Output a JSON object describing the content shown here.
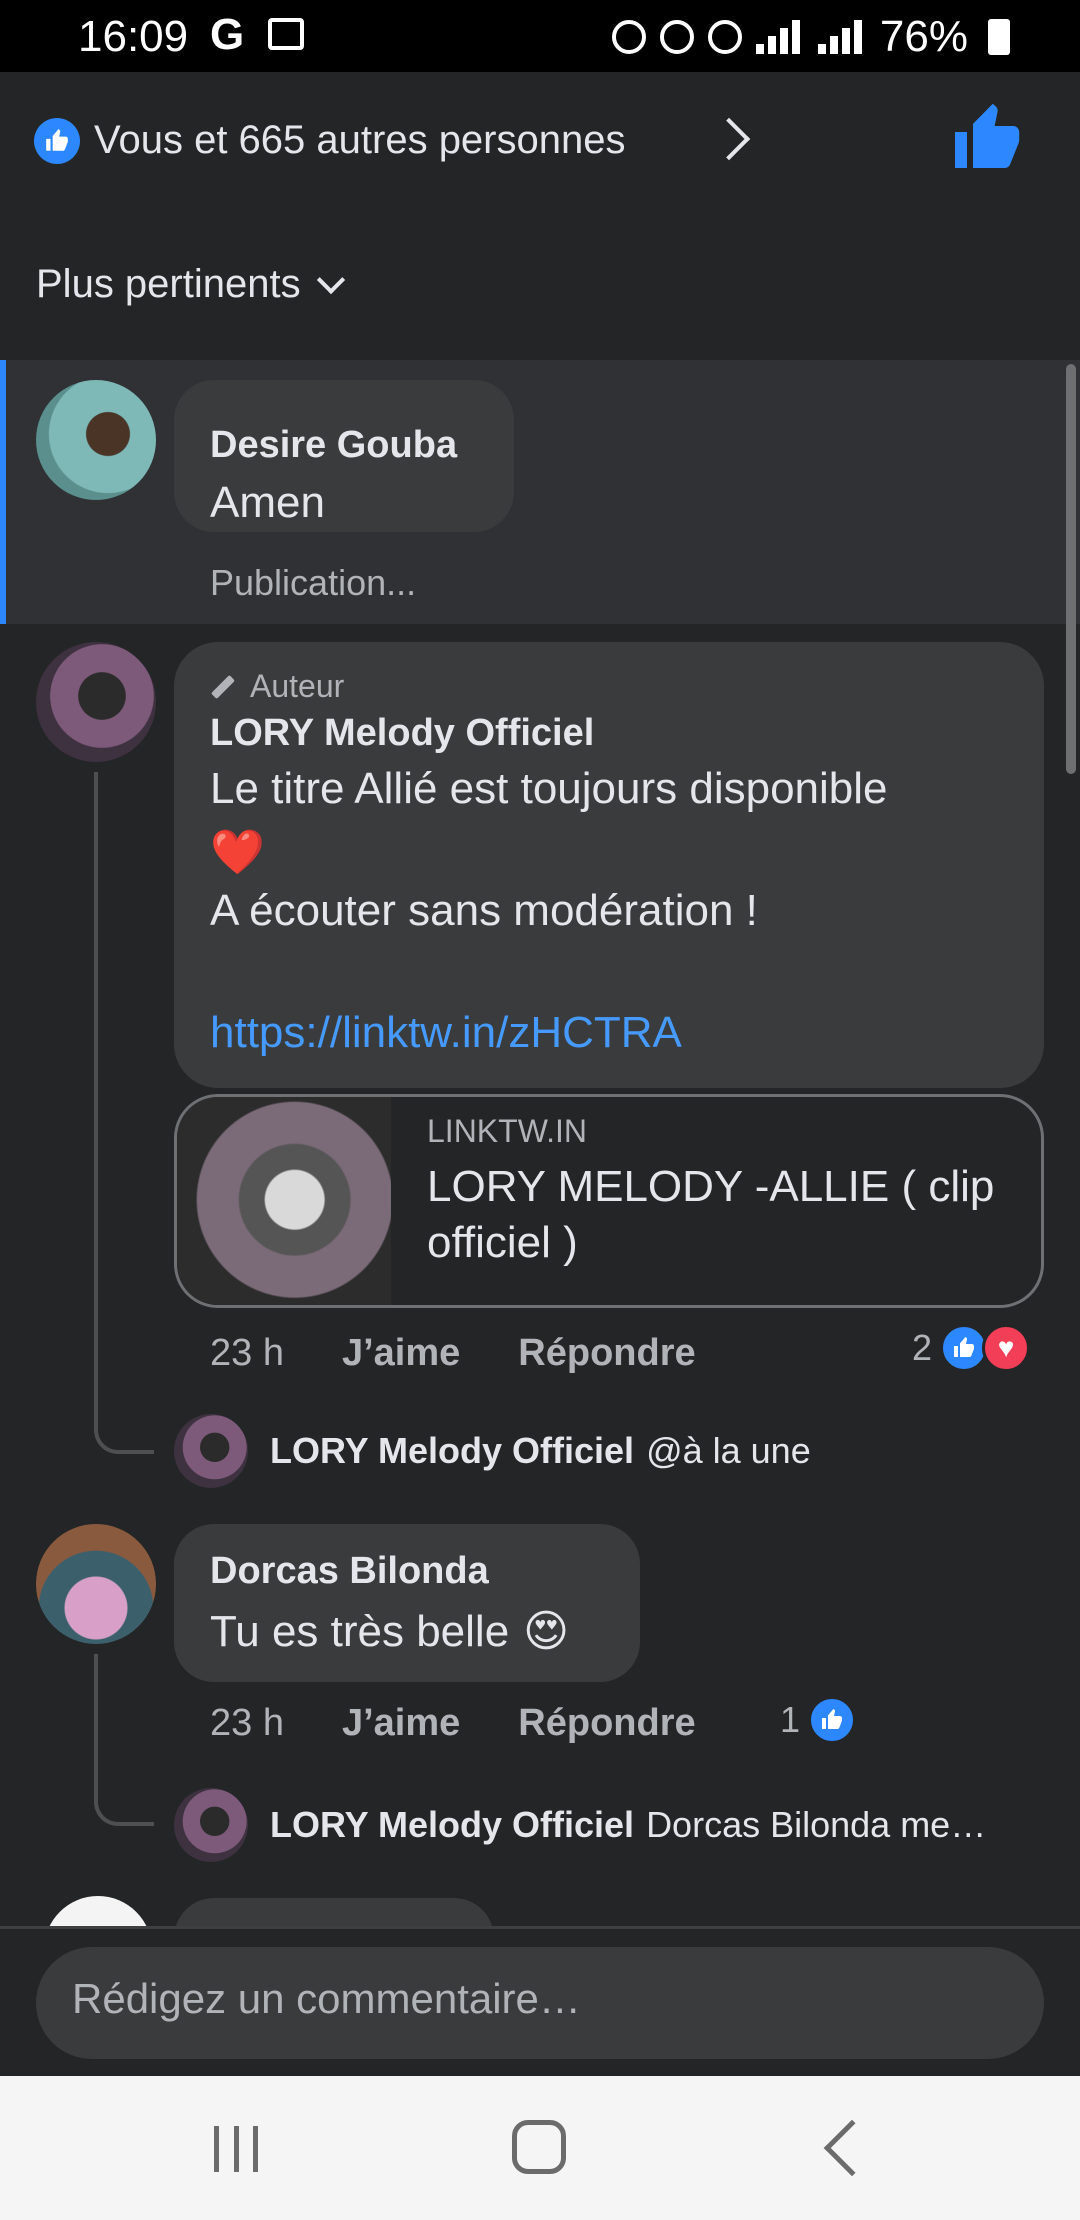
{
  "status_bar": {
    "time": "16:09",
    "g_label": "G",
    "battery": "76%"
  },
  "reactions_header": {
    "text": "Vous et 665 autres personnes"
  },
  "sort": {
    "label": "Plus pertinents"
  },
  "comments": [
    {
      "author": "Desire Gouba",
      "text": "Amen",
      "meta": "Publication..."
    },
    {
      "author_tag": "Auteur",
      "author": "LORY Melody Officiel",
      "line1": "Le titre Allié est toujours disponible",
      "emoji": "❤️",
      "line2": "A écouter sans modération !",
      "link": "https://linktw.in/zHCTRA",
      "link_card": {
        "domain": "LINKTW.IN",
        "title": "LORY MELODY -ALLIE ( clip officiel )"
      },
      "time": "23 h",
      "like": "J’aime",
      "reply": "Répondre",
      "reaction_count": "2",
      "reply_preview": {
        "author": "LORY Melody Officiel",
        "text": "@à la une"
      }
    },
    {
      "author": "Dorcas Bilonda",
      "text": "Tu es très belle",
      "emoji": "😍",
      "time": "23 h",
      "like": "J’aime",
      "reply": "Répondre",
      "reaction_count": "1",
      "reply_preview": {
        "author": "LORY Melody Officiel",
        "text": "Dorcas Bilonda me…"
      }
    }
  ],
  "composer": {
    "placeholder": "Rédigez un commentaire…"
  },
  "colors": {
    "accent": "#2d88ff",
    "background": "#242526",
    "bubble": "#3a3b3c",
    "heart": "#f33e58"
  }
}
